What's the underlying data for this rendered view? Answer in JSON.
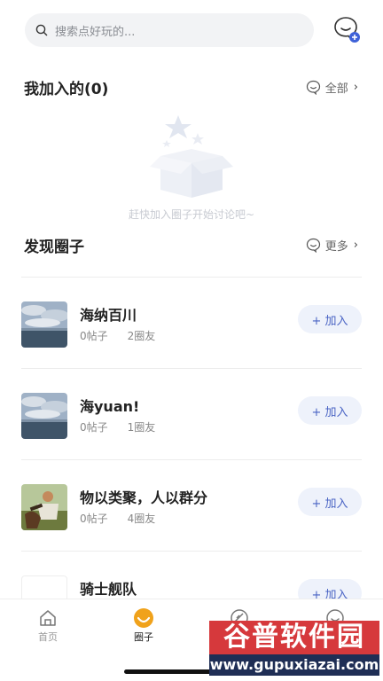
{
  "search": {
    "placeholder": "搜索点好玩的..."
  },
  "joined": {
    "title": "我加入的(0)",
    "link": "全部",
    "empty_text": "赶快加入圈子开始讨论吧~"
  },
  "discover": {
    "title": "发现圈子",
    "link": "更多"
  },
  "circles": [
    {
      "name": "海纳百川",
      "posts": "0帖子",
      "members": "2圈友",
      "join": "+ 加入"
    },
    {
      "name": "海yuan!",
      "posts": "0帖子",
      "members": "1圈友",
      "join": "+ 加入"
    },
    {
      "name": "物以类聚，人以群分",
      "posts": "0帖子",
      "members": "4圈友",
      "join": "+ 加入"
    },
    {
      "name": "骑士舰队",
      "posts": "",
      "members": "",
      "join": "+ 加入"
    }
  ],
  "tabs": [
    {
      "label": "首页",
      "icon": "home-icon"
    },
    {
      "label": "圈子",
      "icon": "circle-icon"
    },
    {
      "label": "",
      "icon": "compass-icon"
    },
    {
      "label": "",
      "icon": "profile-icon"
    }
  ],
  "watermark": {
    "brand": "谷普软件园",
    "url": "www.gupuxiazai.com"
  },
  "colors": {
    "accent": "#4a64c4",
    "join_bg": "#eef2fb",
    "active_tab": "#f0a21b"
  }
}
